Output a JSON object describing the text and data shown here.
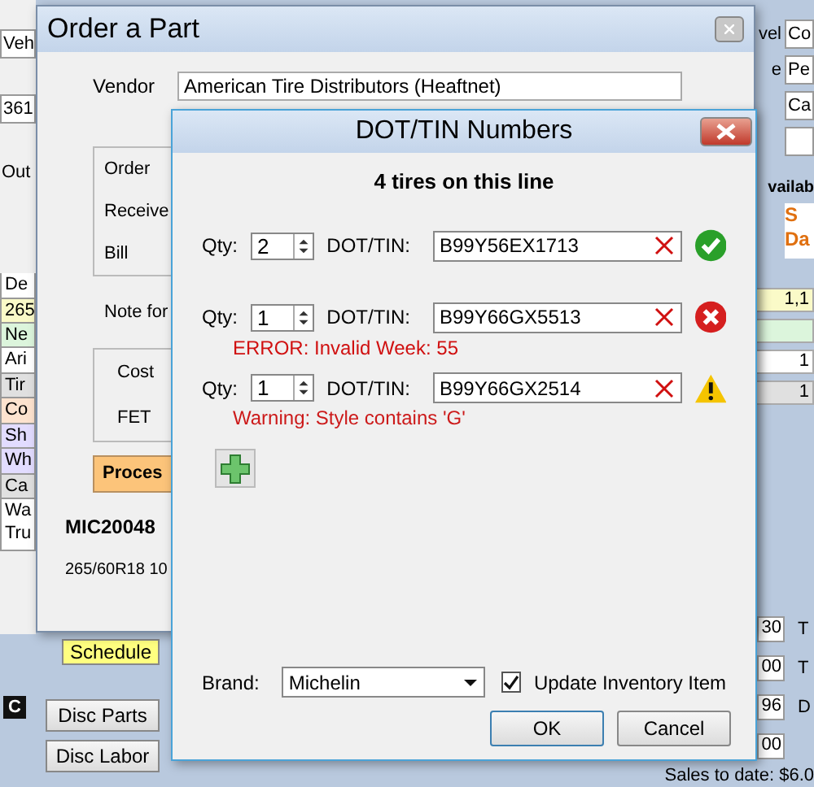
{
  "background_app": {
    "left_fields": [
      {
        "label": "Veh",
        "kind": "field"
      },
      {
        "label": "361",
        "kind": "field"
      },
      {
        "label": "Out",
        "kind": "text"
      }
    ],
    "left_rows": [
      {
        "text": "De",
        "color": "#ffffff"
      },
      {
        "text": "265",
        "color": "#fafac8"
      },
      {
        "text": "Ne",
        "color": "#dcf5dc"
      },
      {
        "text": "Ari",
        "color": "#ffffff"
      },
      {
        "text": "Tir",
        "color": "#e0e0e0"
      },
      {
        "text": "Co",
        "color": "#fde3cf"
      },
      {
        "text": "Sh",
        "color": "#e2dcff"
      },
      {
        "text": "Wh",
        "color": "#e2dcff"
      },
      {
        "text": "Ca",
        "color": "#e0e0e0"
      },
      {
        "text": "Wa\nTru",
        "color": "#ffffff"
      }
    ],
    "left_buttons": [
      {
        "label": "Schedule",
        "kind": "yellow"
      },
      {
        "label": "Disc Parts",
        "kind": "plain"
      },
      {
        "label": "Disc Labor",
        "kind": "plain"
      }
    ],
    "left_badge": "C",
    "right_fields": [
      {
        "label": "vel",
        "value": "Co"
      },
      {
        "label": "e",
        "value": "Pe"
      },
      {
        "value": "Ca"
      }
    ],
    "available_label": "vailab",
    "special_label": "S\nDa",
    "right_rows": [
      {
        "text": "1,1",
        "color": "#fafac8"
      },
      {
        "text": "",
        "color": "#dcf5dc"
      },
      {
        "text": "1",
        "color": "#ffffff"
      },
      {
        "text": "1",
        "color": "#e0e0e0"
      }
    ],
    "totals": [
      {
        "value": "30",
        "label": "T"
      },
      {
        "value": "00",
        "label": "T"
      },
      {
        "value": "96",
        "label": "D"
      },
      {
        "value": "00"
      }
    ],
    "sales": "Sales to date: $6.0"
  },
  "order_window": {
    "title": "Order a Part",
    "vendor_label": "Vendor",
    "vendor": "American Tire Distributors (Heaftnet)",
    "order_labels": [
      "Order",
      "Receive",
      "Bill"
    ],
    "note_label": "Note for",
    "cost_labels": [
      "Cost",
      "FET"
    ],
    "process_button": "Proces",
    "part_code": "MIC20048",
    "part_desc": "265/60R18 10"
  },
  "dot_dialog": {
    "title": "DOT/TIN Numbers",
    "heading": "4 tires on this line",
    "rows": [
      {
        "qty_label": "Qty:",
        "qty": "2",
        "dot_label": "DOT/TIN:",
        "dot": "B99Y56EX1713",
        "kind": "ok"
      },
      {
        "qty_label": "Qty:",
        "qty": "1",
        "dot_label": "DOT/TIN:",
        "dot": "B99Y66GX5513",
        "kind": "error",
        "message": "ERROR: Invalid Week: 55"
      },
      {
        "qty_label": "Qty:",
        "qty": "1",
        "dot_label": "DOT/TIN:",
        "dot": "B99Y66GX2514",
        "kind": "warning",
        "message": "Warning: Style contains 'G'"
      }
    ],
    "brand_label": "Brand:",
    "brand": "Michelin",
    "update_inventory": {
      "label": "Update Inventory Item",
      "checked": true
    },
    "buttons": [
      "OK",
      "Cancel"
    ]
  }
}
